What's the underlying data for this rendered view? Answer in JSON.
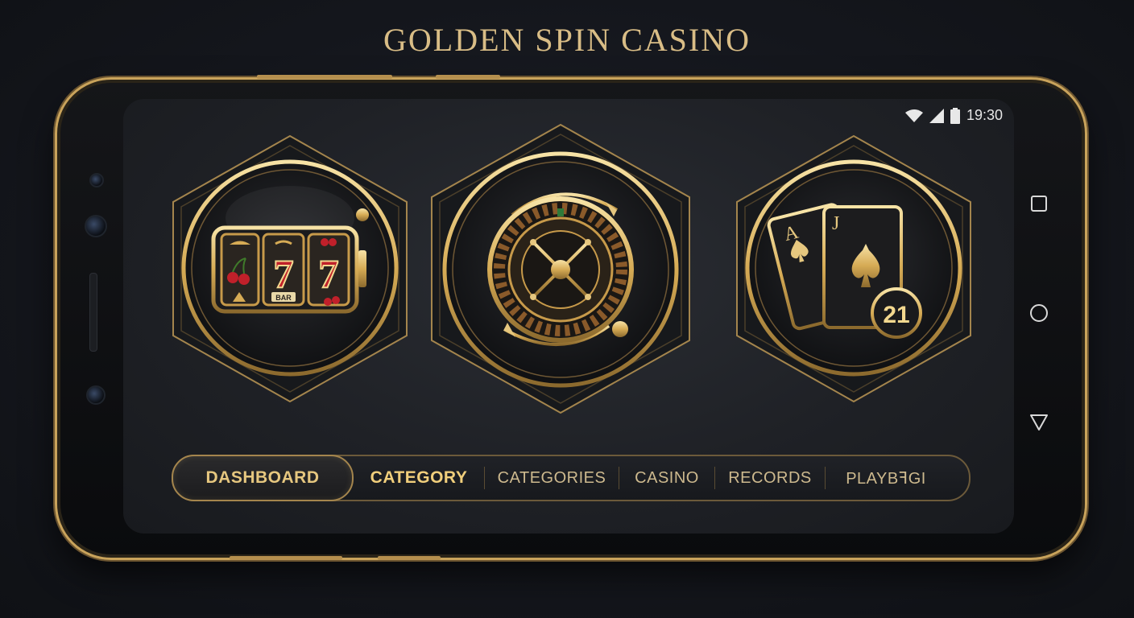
{
  "app_title": "GOLDEN SPIN CASINO",
  "status_bar": {
    "time": "19:30",
    "icons": [
      "wifi-icon",
      "signal-icon",
      "battery-icon"
    ]
  },
  "system_nav": {
    "icons": [
      "recent-apps-square-icon",
      "home-circle-icon",
      "back-triangle-icon"
    ]
  },
  "game_tiles": [
    {
      "name": "slot-machine",
      "icon": "slot-machine-icon",
      "reel_text": [
        "7",
        "7"
      ],
      "bar_label": "BAR"
    },
    {
      "name": "roulette",
      "icon": "roulette-wheel-icon"
    },
    {
      "name": "blackjack",
      "icon": "playing-cards-icon",
      "card_ranks": [
        "A",
        "J"
      ],
      "badge": "21"
    }
  ],
  "tabs": [
    {
      "label": "DASHBOARD",
      "state": "active"
    },
    {
      "label": "CATEGORY",
      "state": "highlighted"
    },
    {
      "label": "CATEGORIES",
      "state": "normal"
    },
    {
      "label": "CASINO",
      "state": "normal"
    },
    {
      "label": "RECORDS",
      "state": "normal"
    },
    {
      "label": "PLAYBꟻGI",
      "state": "normal"
    }
  ],
  "colors": {
    "gold": "#d9b56a",
    "gold_light": "#f3d88f",
    "background": "#14161c",
    "screen": "#1f2126",
    "cherry_red": "#c0202a"
  }
}
